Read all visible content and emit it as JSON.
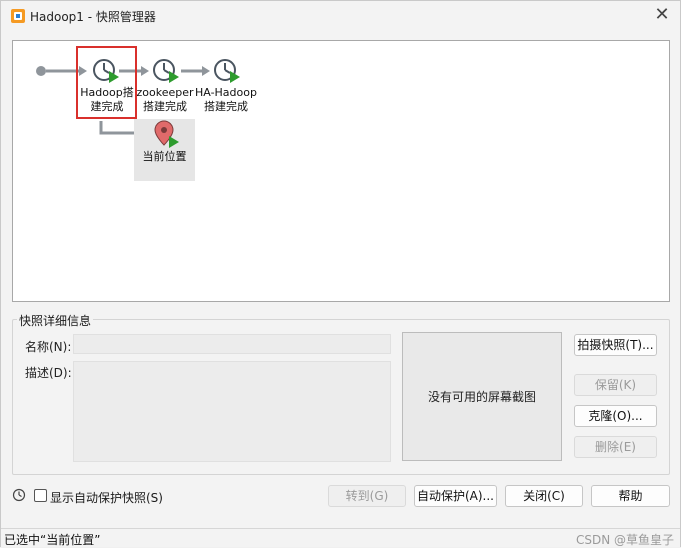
{
  "window": {
    "title": "Hadoop1 - 快照管理器",
    "icon": "vmware-icon",
    "close_icon": "close-icon"
  },
  "tree": {
    "snapshots": [
      {
        "label": "Hadoop搭\n建完成",
        "icon": "clock-play-icon",
        "selected_frame": true
      },
      {
        "label": "zookeeper\n搭建完成",
        "icon": "clock-play-icon"
      },
      {
        "label": "HA-Hadoop\n搭建完成",
        "icon": "clock-play-icon"
      }
    ],
    "current": {
      "label": "当前位置",
      "icon": "location-pin-icon"
    }
  },
  "details": {
    "group_title": "快照详细信息",
    "name_label": "名称(N):",
    "name_value": "",
    "desc_label": "描述(D):",
    "desc_value": "",
    "no_screenshot": "没有可用的屏幕截图"
  },
  "side_buttons": {
    "take": "拍摄快照(T)...",
    "keep": "保留(K)",
    "clone": "克隆(O)...",
    "delete": "删除(E)"
  },
  "bottom": {
    "show_autoprotect": "显示自动保护快照(S)",
    "goto": "转到(G)",
    "autoprotect": "自动保护(A)...",
    "close": "关闭(C)",
    "help": "帮助"
  },
  "status": {
    "text": "已选中“当前位置”",
    "watermark": "CSDN @草鱼皇子"
  },
  "colors": {
    "accent_green": "#2e9c2e",
    "selection_red": "#d9302c",
    "pin_red": "#e06a6a",
    "arrow_gray": "#8f959b",
    "clock_dark": "#4a5560"
  }
}
